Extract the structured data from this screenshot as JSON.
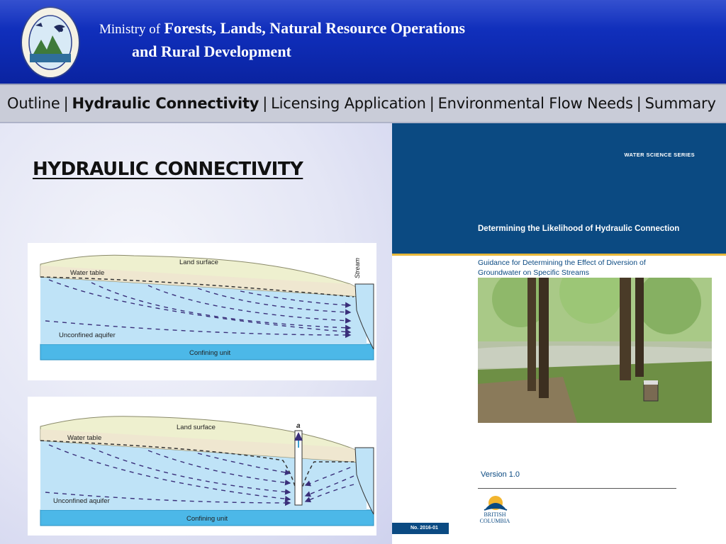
{
  "header": {
    "ministry_prefix": "Ministry of",
    "ministry_line1": "Forests, Lands, Natural Resource Operations",
    "ministry_line2": "and Rural Development",
    "logo": {
      "name": "bc-ministry-seal-icon",
      "text": "British Columbia · Forests, Lands and Natural Resource Operations"
    }
  },
  "nav": {
    "items": [
      {
        "label": "Outline",
        "active": false
      },
      {
        "label": "Hydraulic Connectivity",
        "active": true
      },
      {
        "label": "Licensing Application",
        "active": false
      },
      {
        "label": "Environmental Flow Needs",
        "active": false
      },
      {
        "label": "Summary",
        "active": false
      }
    ],
    "separator": "|"
  },
  "slide": {
    "title": "HYDRAULIC CONNECTIVITY"
  },
  "diagram1": {
    "labels": {
      "land_surface": "Land surface",
      "water_table": "Water table",
      "stream": "Stream",
      "aquifer": "Unconfined aquifer",
      "confining": "Confining unit"
    }
  },
  "diagram2": {
    "labels": {
      "land_surface": "Land surface",
      "water_table": "Water table",
      "well": "a",
      "aquifer": "Unconfined aquifer",
      "confining": "Confining unit"
    }
  },
  "cover": {
    "series": "WATER SCIENCE SERIES",
    "title": "Determining the Likelihood of Hydraulic Connection",
    "subtitle": "Guidance for Determining the Effect of Diversion of Groundwater on Specific Streams",
    "version": "Version 1.0",
    "bc_logo_text": "BRITISH COLUMBIA",
    "number": "No. 2016-01"
  },
  "colors": {
    "header_blue": "#0f2db8",
    "cover_blue": "#0b4a82",
    "water_blue": "#bfe3f7",
    "confining_blue": "#4cb8e8",
    "land_tan": "#eef0cf"
  }
}
